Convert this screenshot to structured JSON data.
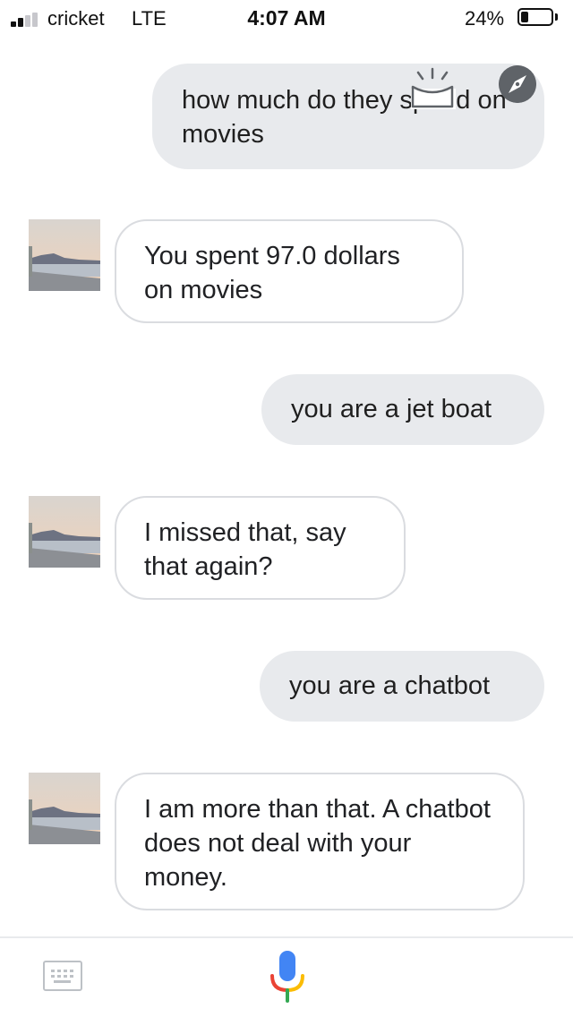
{
  "status_bar": {
    "carrier": "cricket",
    "network": "LTE",
    "time": "4:07 AM",
    "battery_percent": "24%",
    "battery_level": 0.24
  },
  "messages": [
    {
      "sender": "user",
      "text": "how much do they spend on movies"
    },
    {
      "sender": "assistant",
      "text": "You spent 97.0 dollars on movies"
    },
    {
      "sender": "user",
      "text": "you are a jet boat"
    },
    {
      "sender": "assistant",
      "text": "I missed that, say that again?"
    },
    {
      "sender": "user",
      "text": "you are a chatbot"
    },
    {
      "sender": "assistant",
      "text": "I am more than that. A chatbot does not deal with your money."
    }
  ],
  "icons": {
    "assistant_badge": "compass-icon",
    "screenshot_drop": "tray-drop-icon",
    "keyboard": "keyboard-icon",
    "mic": "mic-icon",
    "avatar": "avatar-landscape"
  },
  "colors": {
    "user_bubble": "#e8eaed",
    "bot_border": "#dadce0",
    "mic_blue": "#4285f4",
    "mic_red": "#ea4335",
    "mic_yellow": "#fbbc05",
    "mic_green": "#34a853"
  }
}
